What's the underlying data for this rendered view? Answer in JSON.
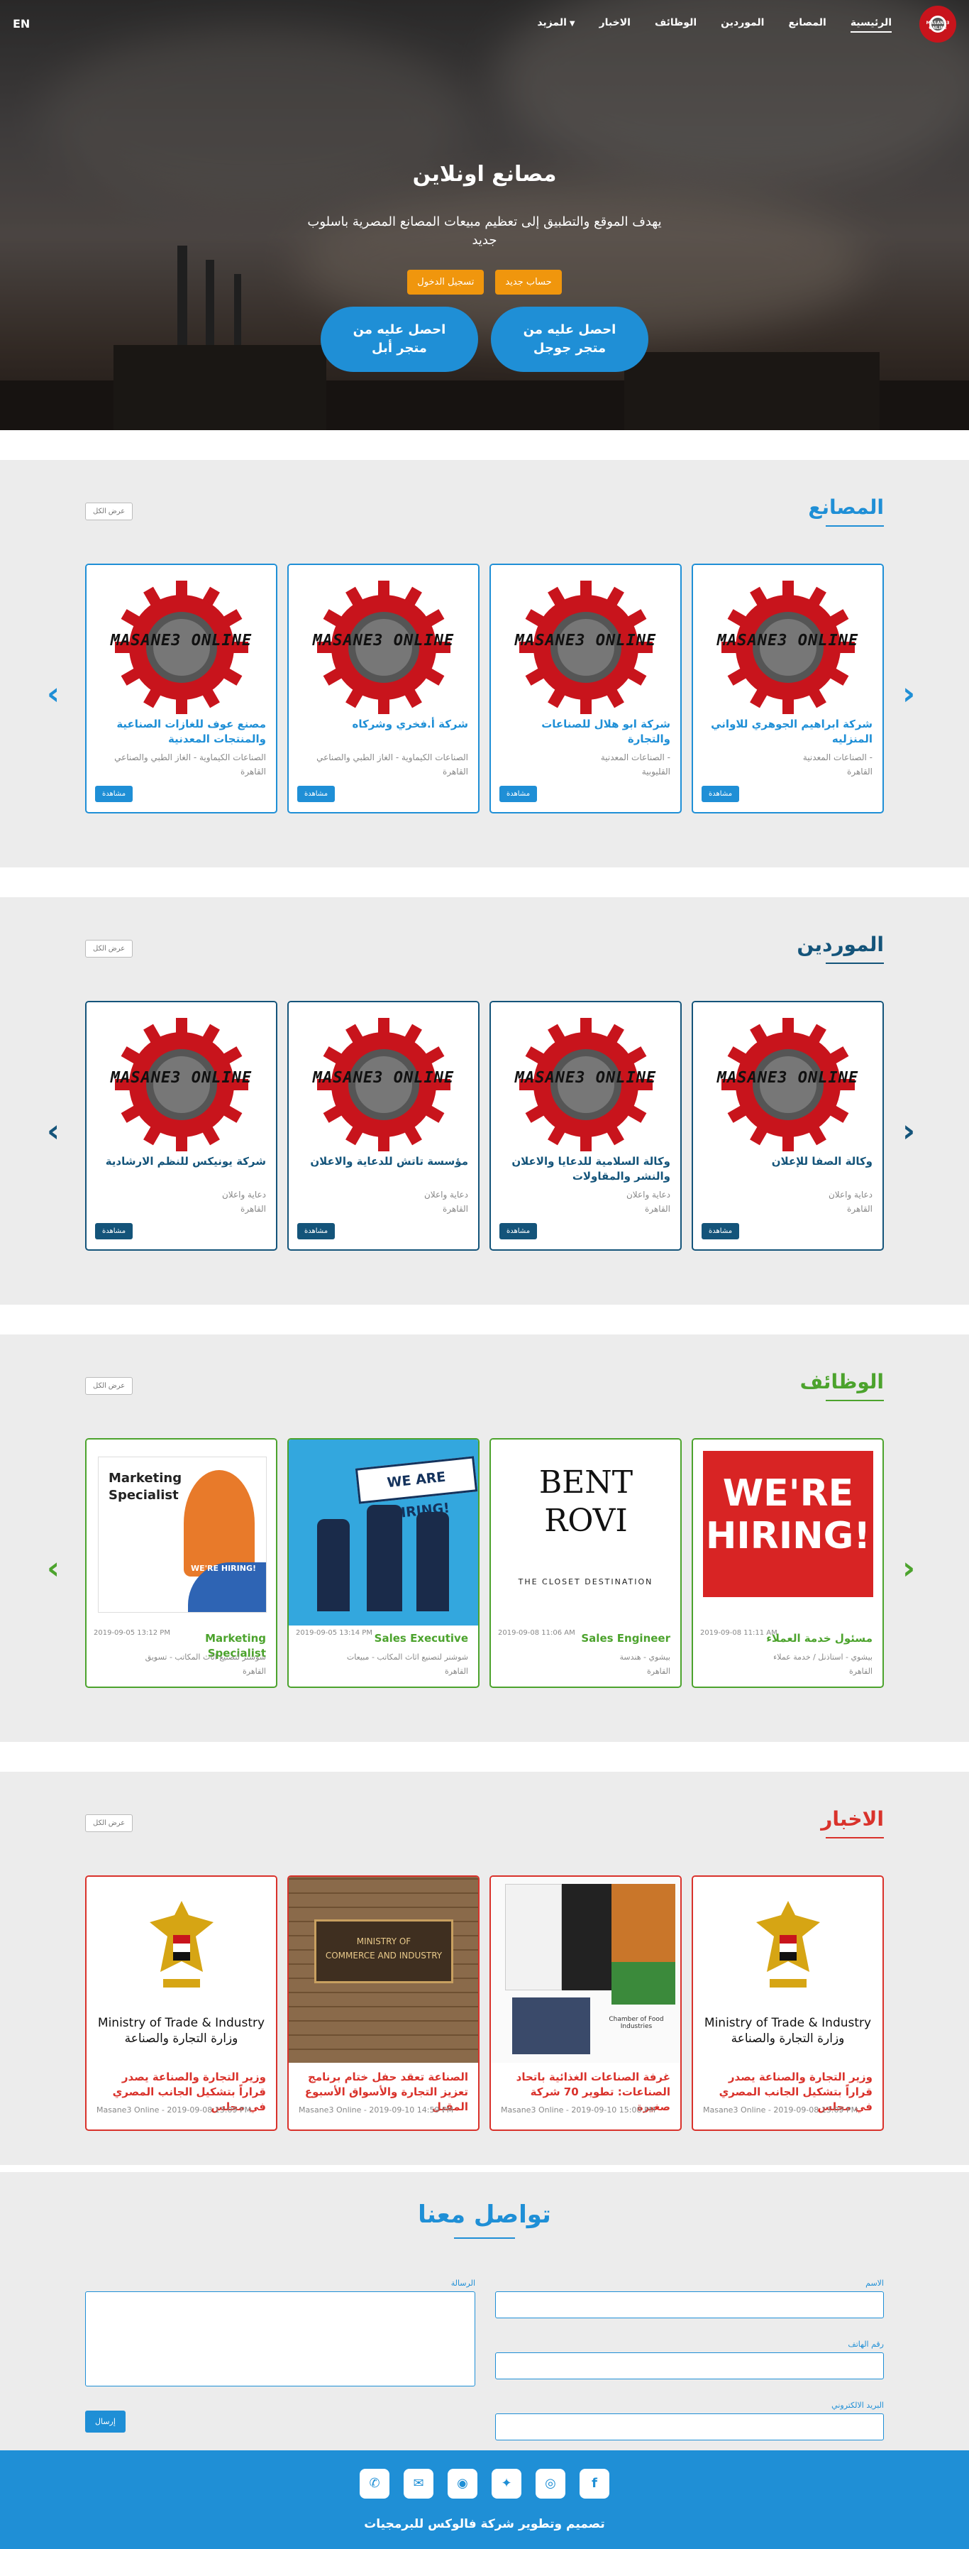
{
  "nav": {
    "lang": "EN",
    "items": [
      "الرئيسية",
      "المصانع",
      "الموردين",
      "الوظائف",
      "الاخبار",
      "المزيد"
    ],
    "brand_mark": "MASANE3 ONLINE"
  },
  "hero": {
    "title": "مصانع اونلاين",
    "subtitle": "يهدف الموقع والتطبيق إلى تعظيم مبيعات المصانع المصرية باسلوب جديد",
    "new_account": "حساب جديد",
    "login": "تسجيل الدخول",
    "google_store": "احصل عليه من متجر جوجل",
    "apple_store": "احصل عليه من متجر أبل"
  },
  "factories": {
    "title": "المصانع",
    "more": "عرض الكل",
    "color": "#1f8fd6",
    "cards": [
      {
        "title": "شركة ابراهيم الجوهري للاواني المنزليه",
        "category": "الصناعات المعدنية -",
        "location": "القاهرة",
        "badge": "مشاهدة"
      },
      {
        "title": "شركة ابو هلال للصناعات والتجارة",
        "category": "الصناعات المعدنية -",
        "location": "القليوبية",
        "badge": "مشاهدة"
      },
      {
        "title": "شركة أ.فخري وشركاه",
        "category": "الصناعات الكيماوية - الغاز الطبي والصناعي",
        "location": "القاهرة",
        "badge": "مشاهدة"
      },
      {
        "title": "مصنع عوف للغازات الصناعية والمنتجات المعدنية",
        "category": "الصناعات الكيماوية - الغاز الطبي والصناعي",
        "location": "القاهرة",
        "badge": "مشاهدة"
      }
    ],
    "brand_text": "MASANE3 ONLINE"
  },
  "suppliers": {
    "title": "الموردين",
    "more": "عرض الكل",
    "color": "#14547a",
    "cards": [
      {
        "title": "وكالة الصفا للإعلان",
        "category": "دعاية واعلان",
        "location": "القاهرة",
        "badge": "مشاهدة"
      },
      {
        "title": "وكالة السلامية للدعايا والاعلان والنشر والمقاولات",
        "category": "دعاية واعلان",
        "location": "القاهرة",
        "badge": "مشاهدة"
      },
      {
        "title": "مؤسسة تاتش للدعاية والاعلان",
        "category": "دعاية واعلان",
        "location": "القاهرة",
        "badge": "مشاهدة"
      },
      {
        "title": "شركة يونيكس للنظم الارشادية",
        "category": "دعاية واعلان",
        "location": "القاهرة",
        "badge": "مشاهدة"
      }
    ]
  },
  "jobs": {
    "title": "الوظائف",
    "more": "عرض الكل",
    "color": "#4ca32d",
    "cards": [
      {
        "title": "مسئول خدمة العملاء",
        "date": "2019-09-08 11:11 AM",
        "category": "بيشوي - استاذنل / خدمة عملاء",
        "location": "القاهرة",
        "image_text": [
          "WE'RE",
          "HIRING!"
        ]
      },
      {
        "title": "Sales Engineer",
        "date": "2019-09-08 11:06 AM",
        "category": "بيشوي - هندسة",
        "location": "القاهرة",
        "image_text": [
          "BENT",
          "ROVI",
          "THE CLOSET DESTINATION"
        ]
      },
      {
        "title": "Sales Executive",
        "date": "2019-09-05 13:14 PM",
        "category": "شوشنر لتصنيع اثاث المكاتب - مبيعات",
        "location": "القاهرة",
        "image_text": [
          "WE ARE HIRING!"
        ]
      },
      {
        "title": "Marketing Specialist",
        "date": "2019-09-05 13:12 PM",
        "category": "شوشنر لتصنيع اثاث المكاتب - تسويق",
        "location": "القاهرة",
        "image_text": [
          "Marketing",
          "Specialist",
          "WE'RE HIRING!"
        ]
      }
    ]
  },
  "news": {
    "title": "الاخبار",
    "more": "عرض الكل",
    "color": "#d9322b",
    "cards": [
      {
        "title": "وزير التجارة والصناعة يصدر قراراً بتشكيل الجانب المصري في مجلس",
        "meta": "Masane3 Online - 2019-09-08 13:09 PM",
        "image_text": [
          "Ministry of Trade & Industry",
          "وزارة التجارة والصناعة"
        ]
      },
      {
        "title": "غرفة الصناعات الغذائية باتحاد الصناعات: تطوير 70 شركة صغيرة",
        "meta": "Masane3 Online - 2019-09-10 15:08 PM",
        "image_text": [
          "Chamber of Food Industries"
        ]
      },
      {
        "title": "الصناعة تعقد حفل ختام برنامج تعزيز التجارة والأسواق الأسبوع المقبل",
        "meta": "Masane3 Online - 2019-09-10 14:59 PM",
        "image_text": [
          "MINISTRY OF",
          "COMMERCE AND INDUSTRY"
        ]
      },
      {
        "title": "وزير التجارة والصناعة يصدر قراراً بتشكيل الجانب المصري في مجلس",
        "meta": "Masane3 Online - 2019-09-08 13:09 PM",
        "image_text": [
          "Ministry of Trade & Industry",
          "وزارة التجارة والصناعة"
        ]
      }
    ]
  },
  "contact": {
    "title": "تواصل معنا",
    "name_label": "الاسم",
    "phone_label": "رقم الهاتف",
    "email_label": "البريد الالكتروني",
    "message_label": "الرسالة",
    "send": "إرسال"
  },
  "footer": {
    "credit": "تصميم وتطوير شركة فالوكس للبرمجيات",
    "socials": [
      "phone-icon",
      "email-icon",
      "whatsapp-icon",
      "twitter-icon",
      "instagram-icon",
      "facebook-icon"
    ]
  }
}
